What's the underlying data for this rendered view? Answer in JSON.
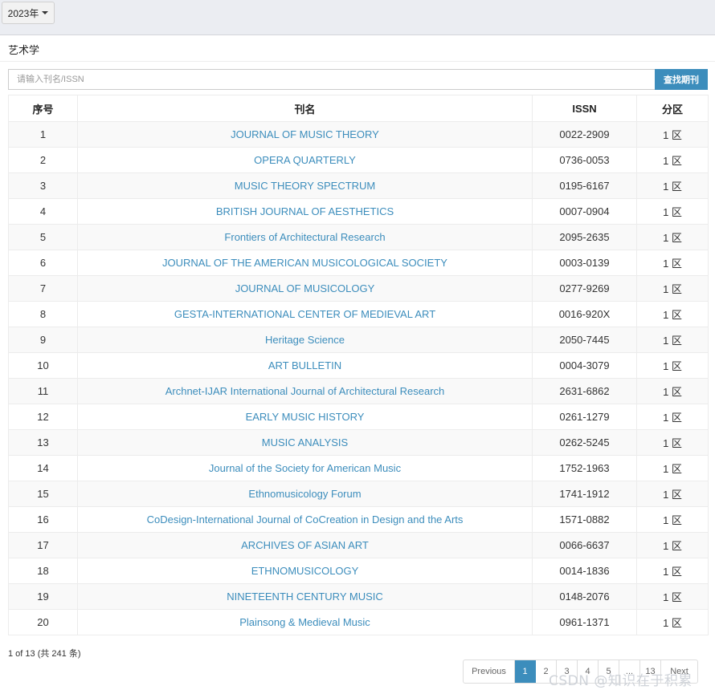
{
  "year_selector": {
    "label": "2023年"
  },
  "panel": {
    "title": "艺术学"
  },
  "search": {
    "placeholder": "请输入刊名/ISSN",
    "button_label": "查找期刊"
  },
  "table": {
    "headers": [
      "序号",
      "刊名",
      "ISSN",
      "分区"
    ],
    "rows": [
      {
        "no": "1",
        "name": "JOURNAL OF MUSIC THEORY",
        "issn": "0022-2909",
        "zone": "1 区"
      },
      {
        "no": "2",
        "name": "OPERA QUARTERLY",
        "issn": "0736-0053",
        "zone": "1 区"
      },
      {
        "no": "3",
        "name": "MUSIC THEORY SPECTRUM",
        "issn": "0195-6167",
        "zone": "1 区"
      },
      {
        "no": "4",
        "name": "BRITISH JOURNAL OF AESTHETICS",
        "issn": "0007-0904",
        "zone": "1 区"
      },
      {
        "no": "5",
        "name": "Frontiers of Architectural Research",
        "issn": "2095-2635",
        "zone": "1 区"
      },
      {
        "no": "6",
        "name": "JOURNAL OF THE AMERICAN MUSICOLOGICAL SOCIETY",
        "issn": "0003-0139",
        "zone": "1 区"
      },
      {
        "no": "7",
        "name": "JOURNAL OF MUSICOLOGY",
        "issn": "0277-9269",
        "zone": "1 区"
      },
      {
        "no": "8",
        "name": "GESTA-INTERNATIONAL CENTER OF MEDIEVAL ART",
        "issn": "0016-920X",
        "zone": "1 区"
      },
      {
        "no": "9",
        "name": "Heritage Science",
        "issn": "2050-7445",
        "zone": "1 区"
      },
      {
        "no": "10",
        "name": "ART BULLETIN",
        "issn": "0004-3079",
        "zone": "1 区"
      },
      {
        "no": "11",
        "name": "Archnet-IJAR International Journal of Architectural Research",
        "issn": "2631-6862",
        "zone": "1 区"
      },
      {
        "no": "12",
        "name": "EARLY MUSIC HISTORY",
        "issn": "0261-1279",
        "zone": "1 区"
      },
      {
        "no": "13",
        "name": "MUSIC ANALYSIS",
        "issn": "0262-5245",
        "zone": "1 区"
      },
      {
        "no": "14",
        "name": "Journal of the Society for American Music",
        "issn": "1752-1963",
        "zone": "1 区"
      },
      {
        "no": "15",
        "name": "Ethnomusicology Forum",
        "issn": "1741-1912",
        "zone": "1 区"
      },
      {
        "no": "16",
        "name": "CoDesign-International Journal of CoCreation in Design and the Arts",
        "issn": "1571-0882",
        "zone": "1 区"
      },
      {
        "no": "17",
        "name": "ARCHIVES OF ASIAN ART",
        "issn": "0066-6637",
        "zone": "1 区"
      },
      {
        "no": "18",
        "name": "ETHNOMUSICOLOGY",
        "issn": "0014-1836",
        "zone": "1 区"
      },
      {
        "no": "19",
        "name": "NINETEENTH CENTURY MUSIC",
        "issn": "0148-2076",
        "zone": "1 区"
      },
      {
        "no": "20",
        "name": "Plainsong & Medieval Music",
        "issn": "0961-1371",
        "zone": "1 区"
      }
    ]
  },
  "summary": "1 of 13 (共 241 条)",
  "pagination": {
    "previous": "Previous",
    "pages": [
      "1",
      "2",
      "3",
      "4",
      "5",
      "...",
      "13"
    ],
    "active": "1",
    "next": "Next"
  },
  "watermark": "CSDN @知识在于积累",
  "colors": {
    "accent": "#3c8dbc",
    "background": "#ebedf2"
  }
}
